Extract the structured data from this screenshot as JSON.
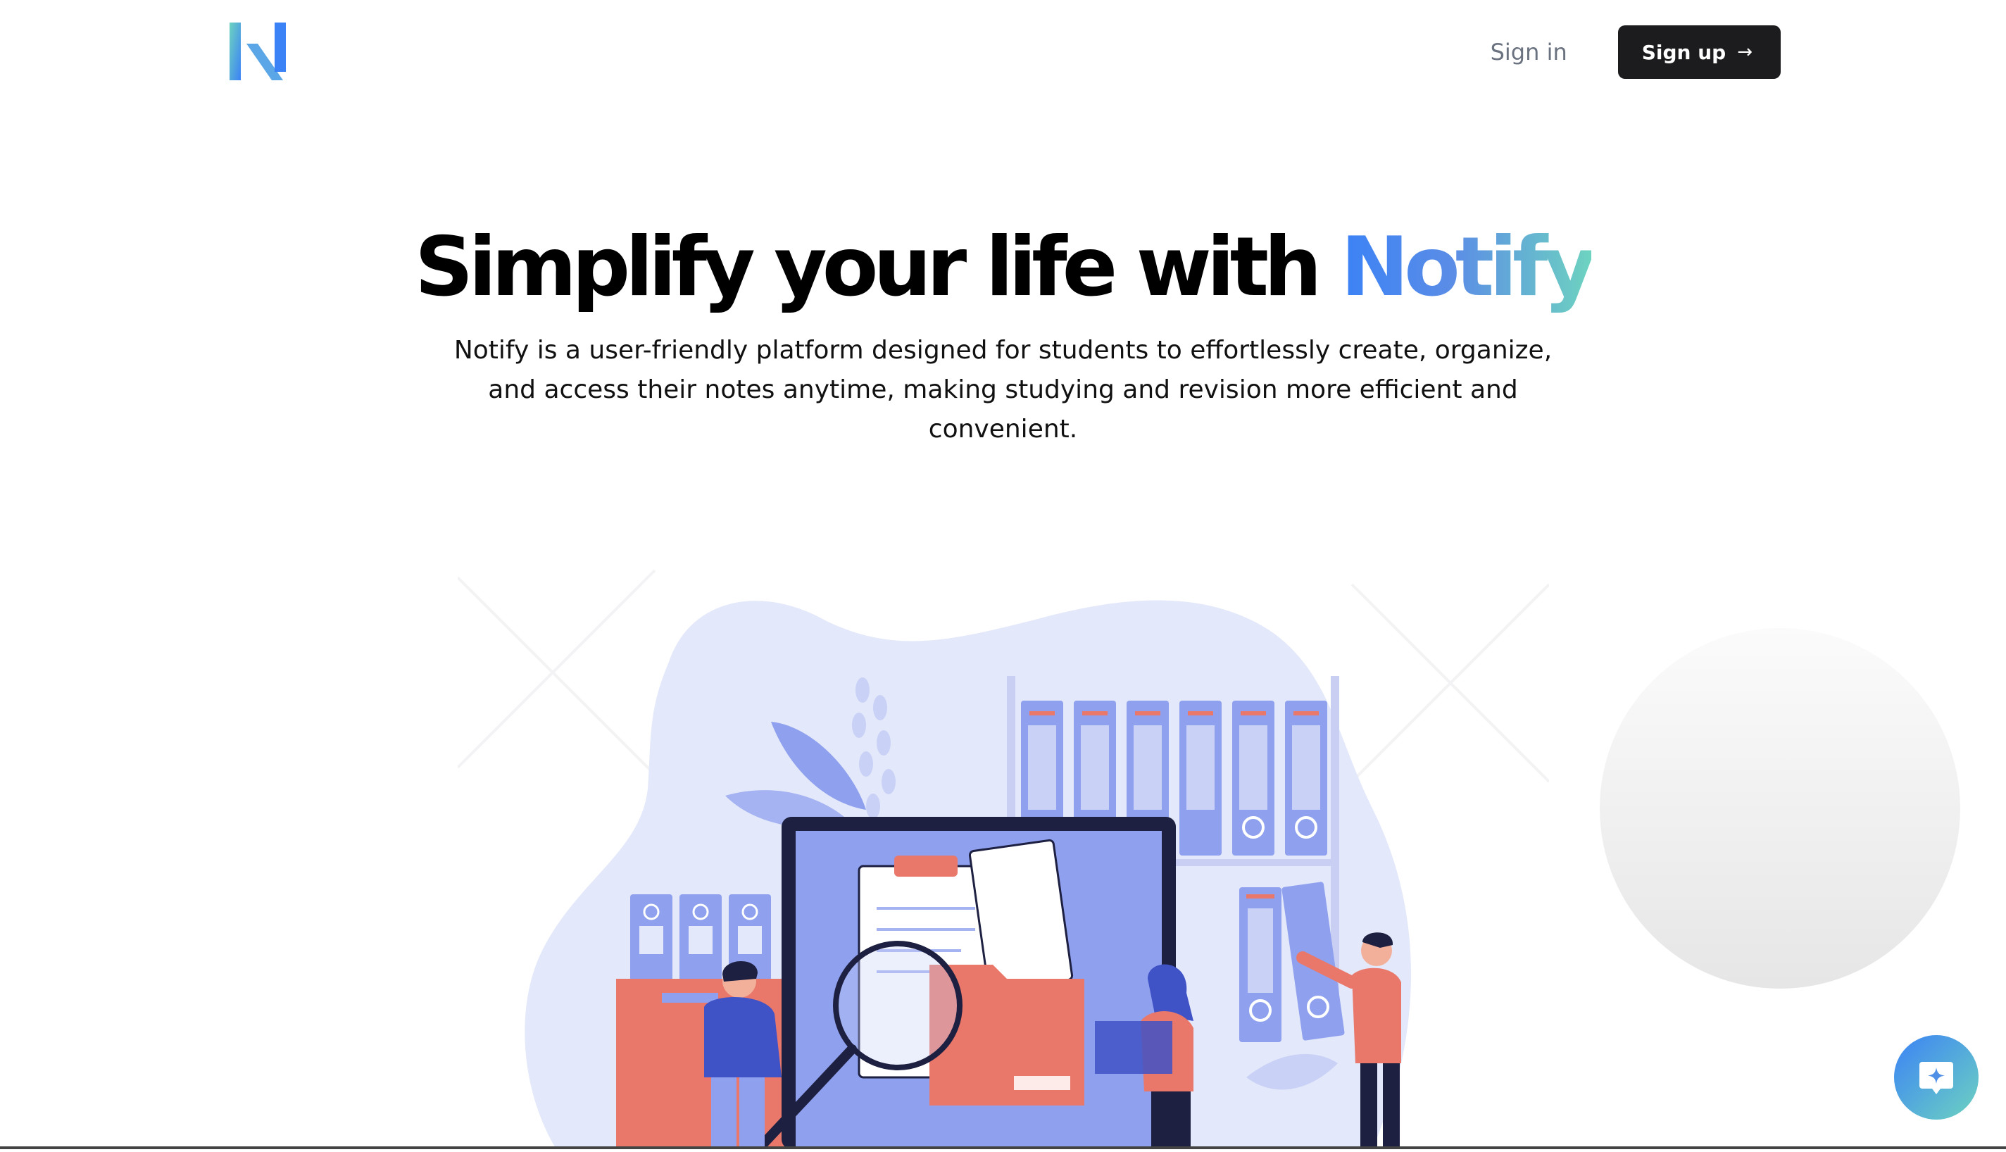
{
  "header": {
    "logo_icon": "notify-logo-n",
    "sign_in_label": "Sign in",
    "sign_up_label": "Sign up",
    "sign_up_icon": "arrow-right-icon"
  },
  "hero": {
    "title_prefix": "Simplify your life with",
    "title_brand": "Notify",
    "description": "Notify is a user-friendly platform designed for students to effortlessly create, organize, and access their notes anytime, making studying and revision more efficient and convenient."
  },
  "illustration": {
    "icon": "file-organization-illustration"
  },
  "chat_widget": {
    "icon": "chat-sparkle-icon"
  },
  "colors": {
    "brand_blue": "#3b82f6",
    "brand_teal": "#6dd3c0",
    "button_dark": "#1c1c1e",
    "illustration_blue": "#8ea0ee",
    "illustration_salmon": "#e9786a"
  }
}
